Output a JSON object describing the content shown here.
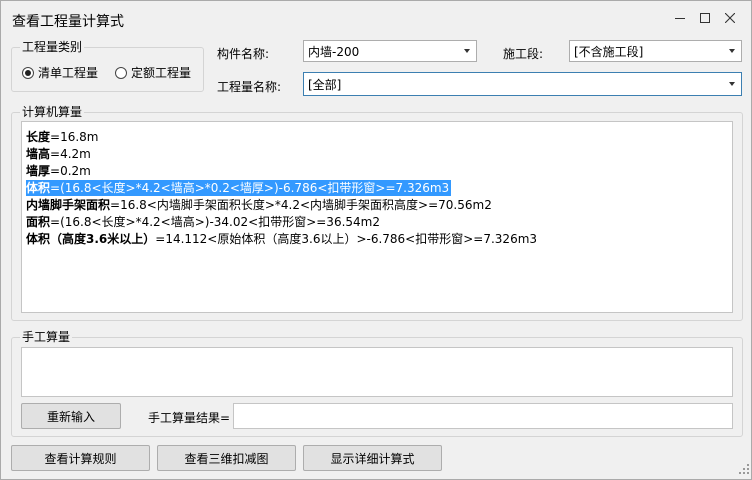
{
  "window": {
    "title": "查看工程量计算式"
  },
  "category_group": {
    "legend": "工程量类别",
    "options": [
      {
        "label": "清单工程量",
        "selected": true
      },
      {
        "label": "定额工程量",
        "selected": false
      }
    ]
  },
  "component": {
    "label": "构件名称:",
    "value": "内墙-200"
  },
  "segment": {
    "label": "施工段:",
    "value": "[不含施工段]"
  },
  "quantity_name": {
    "label": "工程量名称:",
    "value": "[全部]"
  },
  "computer_calc": {
    "legend": "计算机算量",
    "lines": [
      {
        "name": "长度",
        "expr": "=16.8m",
        "selected": false
      },
      {
        "name": "墙高",
        "expr": "=4.2m",
        "selected": false
      },
      {
        "name": "墙厚",
        "expr": "=0.2m",
        "selected": false
      },
      {
        "name": "体积",
        "expr": "=(16.8<长度>*4.2<墙高>*0.2<墙厚>)-6.786<扣带形窗>=7.326m3",
        "selected": true
      },
      {
        "name": "内墙脚手架面积",
        "expr": "=16.8<内墙脚手架面积长度>*4.2<内墙脚手架面积高度>=70.56m2",
        "selected": false
      },
      {
        "name": "面积",
        "expr": "=(16.8<长度>*4.2<墙高>)-34.02<扣带形窗>=36.54m2",
        "selected": false
      },
      {
        "name": "体积（高度3.6米以上）",
        "expr": "=14.112<原始体积（高度3.6以上）>-6.786<扣带形窗>=7.326m3",
        "selected": false
      }
    ]
  },
  "manual_calc": {
    "legend": "手工算量",
    "reenter_button": "重新输入",
    "result_label": "手工算量结果=",
    "result_value": ""
  },
  "footer": {
    "rules_button": "查看计算规则",
    "view3d_button": "查看三维扣减图",
    "detail_button": "显示详细计算式"
  },
  "icons": {
    "minimize": "minimize-icon",
    "maximize": "maximize-icon",
    "close": "close-icon",
    "resize": "resize-grip-icon"
  },
  "colors": {
    "selection": "#3399ff",
    "focus_border": "#3c7fb1"
  }
}
